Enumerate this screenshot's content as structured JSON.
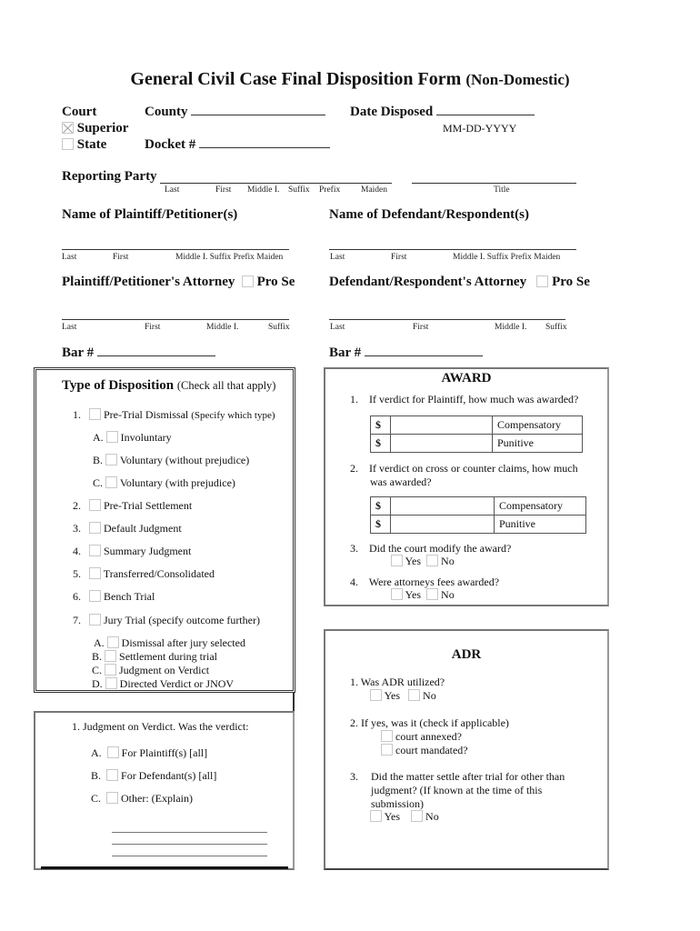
{
  "title": {
    "main": "General Civil Case Final Disposition Form",
    "sub": "(Non-Domestic)"
  },
  "court": {
    "label": "Court",
    "options": [
      {
        "label": "Superior",
        "checked": true
      },
      {
        "label": "State",
        "checked": false
      }
    ]
  },
  "county": {
    "label": "County",
    "value": ""
  },
  "date_disposed": {
    "label": "Date Disposed",
    "value": "",
    "format_hint": "MM-DD-YYYY"
  },
  "docket": {
    "label": "Docket #",
    "value": ""
  },
  "reporting_party": {
    "label": "Reporting Party",
    "name_fields": [
      "Last",
      "First",
      "Middle I.",
      "Suffix",
      "Prefix",
      "Maiden"
    ],
    "title_field": "Title"
  },
  "plaintiff": {
    "heading": "Name of Plaintiff/Petitioner(s)",
    "fields": [
      "Last",
      "First",
      "Middle I. Suffix Prefix Maiden"
    ]
  },
  "defendant": {
    "heading": "Name of Defendant/Respondent(s)",
    "fields": [
      "Last",
      "First",
      "Middle I. Suffix Prefix Maiden"
    ]
  },
  "plaintiff_attorney": {
    "heading": "Plaintiff/Petitioner's Attorney",
    "pro_se": "Pro Se",
    "fields": [
      "Last",
      "First",
      "Middle I.",
      "Suffix"
    ],
    "bar_label": "Bar #"
  },
  "defendant_attorney": {
    "heading": "Defendant/Respondent's Attorney",
    "pro_se": "Pro Se",
    "fields": [
      "Last",
      "First",
      "Middle I.",
      "Suffix"
    ],
    "bar_label": "Bar #"
  },
  "disposition": {
    "heading": "Type of Disposition",
    "heading_note": "(Check all that apply)",
    "items": [
      {
        "num": "1.",
        "label": "Pre-Trial Dismissal",
        "note": "(Specify which type)"
      },
      {
        "num": "2.",
        "label": "Pre-Trial Settlement"
      },
      {
        "num": "3.",
        "label": "Default Judgment"
      },
      {
        "num": "4.",
        "label": "Summary Judgment"
      },
      {
        "num": "5.",
        "label": "Transferred/Consolidated"
      },
      {
        "num": "6.",
        "label": "Bench Trial"
      },
      {
        "num": "7.",
        "label": "Jury Trial (specify outcome further)"
      }
    ],
    "dismissal_sub": [
      {
        "letter": "A.",
        "label": "Involuntary"
      },
      {
        "letter": "B.",
        "label": "Voluntary (without prejudice)"
      },
      {
        "letter": "C.",
        "label": "Voluntary (with prejudice)"
      }
    ],
    "jury_sub": [
      {
        "letter": "A.",
        "label": "Dismissal after jury selected"
      },
      {
        "letter": "B.",
        "label": "Settlement during trial"
      },
      {
        "letter": "C.",
        "label": "Judgment on Verdict"
      },
      {
        "letter": "D.",
        "label": "Directed Verdict or JNOV"
      }
    ]
  },
  "verdict": {
    "question": "1. Judgment on Verdict. Was the verdict:",
    "options": [
      {
        "letter": "A.",
        "label": "For Plaintiff(s) [all]"
      },
      {
        "letter": "B.",
        "label": "For Defendant(s) [all]"
      },
      {
        "letter": "C.",
        "label": "Other: (Explain)"
      }
    ]
  },
  "award": {
    "heading": "AWARD",
    "q1": {
      "num": "1.",
      "text": "If verdict for Plaintiff, how much was awarded?"
    },
    "q2": {
      "num": "2.",
      "text1": "If verdict on cross or counter claims, how much",
      "text2": "was awarded?"
    },
    "rows": [
      {
        "symbol": "$",
        "value": "",
        "label": "Compensatory"
      },
      {
        "symbol": "$",
        "value": "",
        "label": "Punitive"
      }
    ],
    "q3": {
      "num": "3.",
      "text": "Did the court modify the award?"
    },
    "q4": {
      "num": "4.",
      "text": "Were attorneys fees awarded?"
    },
    "yes": "Yes",
    "no": "No"
  },
  "adr": {
    "heading": "ADR",
    "q1": "1.  Was ADR utilized?",
    "q2": "2.   If yes, was it (check if applicable)",
    "q2_options": [
      "court annexed?",
      "court mandated?"
    ],
    "q3_num": "3.",
    "q3_lines": [
      "Did the matter settle after trial for other than",
      "judgment? (If known at the time of this",
      "submission)"
    ],
    "yes": "Yes",
    "no": "No"
  }
}
